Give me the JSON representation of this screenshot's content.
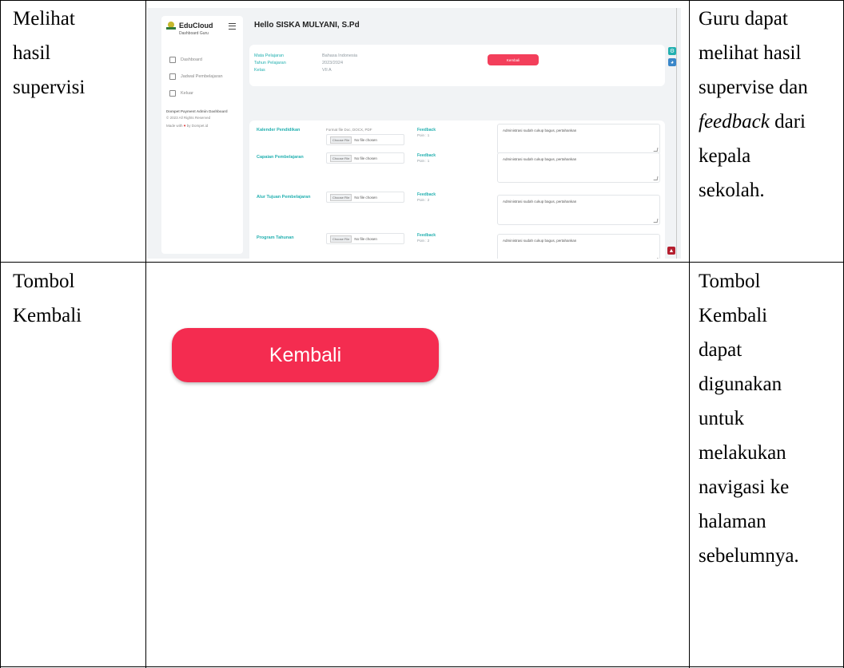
{
  "rows": [
    {
      "feature_lines": [
        "Melihat",
        "hasil",
        "supervisi"
      ],
      "description_lines": [
        "Guru dapat",
        "melihat hasil",
        "supervise dan",
        "feedback dari",
        "kepala",
        "sekolah."
      ],
      "description_italic_word": "feedback"
    },
    {
      "feature_lines": [
        "Tombol",
        "Kembali"
      ],
      "description_lines": [
        "Tombol",
        "Kembali",
        "dapat",
        "digunakan",
        "untuk",
        "melakukan",
        "navigasi ke",
        "halaman",
        "sebelumnya."
      ]
    }
  ],
  "screenshot": {
    "app_name": "EduCloud",
    "app_subtitle": "Dashboard Guru",
    "greeting": "Hello SISKA MULYANI, S.Pd",
    "nav_items": [
      "Dashboard",
      "Jadwal Pembelajaran",
      "Keluar"
    ],
    "footer_line1": "Dompet Payment Admin Dashboard",
    "footer_line2": "© 2023 All Rights Reserved",
    "footer_line3_prefix": "Made with",
    "footer_line3_suffix": "by Dompet.id",
    "info": [
      {
        "label": "Mata Pelajaran",
        "value": "Bahasa Indonesia"
      },
      {
        "label": "Tahun Pelajaran",
        "value": "2023/2024"
      },
      {
        "label": "Kelas",
        "value": "VII A"
      }
    ],
    "back_button_small": "Kembali",
    "file_hint": "Format file Doc, DOCX, PDF",
    "choose_file": "Choose File",
    "no_file": "No file chosen",
    "feedback_label": "Feedback",
    "documents": [
      {
        "name": "Kalender Pendidikan",
        "point": "Poin : 1",
        "feedback": "Administrasi sudah cukup bagus, pertahankan"
      },
      {
        "name": "Capaian Pembelajaran",
        "point": "Poin : 1",
        "feedback": "Administrasi sudah cukup bagus, pertahankan"
      },
      {
        "name": "Alur Tujuan Pembelajaran",
        "point": "Poin : 2",
        "feedback": "Administrasi sudah cukup bagus, pertahankan"
      },
      {
        "name": "Program Tahunan",
        "point": "Poin : 2",
        "feedback": "Administrasi sudah cukup bagus, pertahankan"
      }
    ],
    "colors": {
      "accent": "#23b0b0",
      "danger": "#f33f5b",
      "background": "#f1f3f5"
    }
  },
  "big_button": {
    "label": "Kembali",
    "color": "#f42c50"
  }
}
